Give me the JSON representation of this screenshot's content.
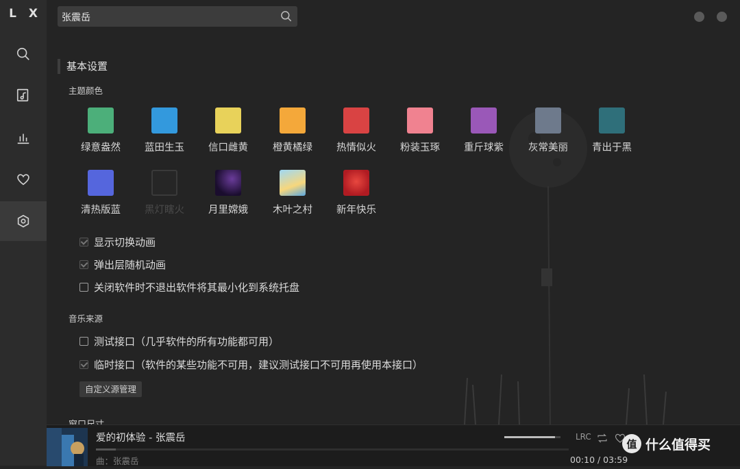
{
  "app": {
    "logo": "L X"
  },
  "sidebar": {
    "items": [
      {
        "name": "search",
        "icon": "search-icon"
      },
      {
        "name": "playlist",
        "icon": "music-list-icon"
      },
      {
        "name": "leaderboard",
        "icon": "bar-chart-icon"
      },
      {
        "name": "favorites",
        "icon": "heart-icon"
      },
      {
        "name": "settings",
        "icon": "settings-icon",
        "active": true
      }
    ]
  },
  "search": {
    "value": "张震岳",
    "placeholder": ""
  },
  "settings": {
    "section_title": "基本设置",
    "theme_title": "主题颜色",
    "themes": [
      {
        "label": "绿意盎然",
        "color": "#4caf7a"
      },
      {
        "label": "蓝田生玉",
        "color": "#3399dd"
      },
      {
        "label": "信口雌黄",
        "color": "#e8d25a"
      },
      {
        "label": "橙黄橘绿",
        "color": "#f4a83a"
      },
      {
        "label": "热情似火",
        "color": "#d94343"
      },
      {
        "label": "粉装玉琢",
        "color": "#f08290"
      },
      {
        "label": "重斤球紫",
        "color": "#9a58b8"
      },
      {
        "label": "灰常美丽",
        "color": "#6e7a8c"
      },
      {
        "label": "青出于黑",
        "color": "#2f6f7a"
      },
      {
        "label": "清热版蓝",
        "color": "#5566dd"
      },
      {
        "label": "黑灯瞎火",
        "color": "#262626",
        "dim": true
      },
      {
        "label": "月里嫦娥",
        "color": "#2a1640"
      },
      {
        "label": "木叶之村",
        "color": "#7ec4e8"
      },
      {
        "label": "新年快乐",
        "color": "#c8232a"
      }
    ],
    "checkboxes": [
      {
        "label": "显示切换动画",
        "checked": true
      },
      {
        "label": "弹出层随机动画",
        "checked": true
      },
      {
        "label": "关闭软件时不退出软件将其最小化到系统托盘",
        "checked": false
      }
    ],
    "source_title": "音乐来源",
    "sources": [
      {
        "label": "测试接口（几乎软件的所有功能都可用）",
        "checked": false
      },
      {
        "label": "临时接口（软件的某些功能不可用，建议测试接口不可用再使用本接口）",
        "checked": true
      }
    ],
    "custom_source_button": "自定义源管理",
    "window_size_title": "窗口尺寸"
  },
  "player": {
    "title": "爱的初体验 - 张震岳",
    "artist": "曲：张震岳",
    "time": "00:10 / 03:59",
    "progress": 0.042,
    "volume": 0.9,
    "lrc_label": "LRC"
  },
  "watermark": {
    "text": "什么值得买",
    "badge": "值"
  }
}
